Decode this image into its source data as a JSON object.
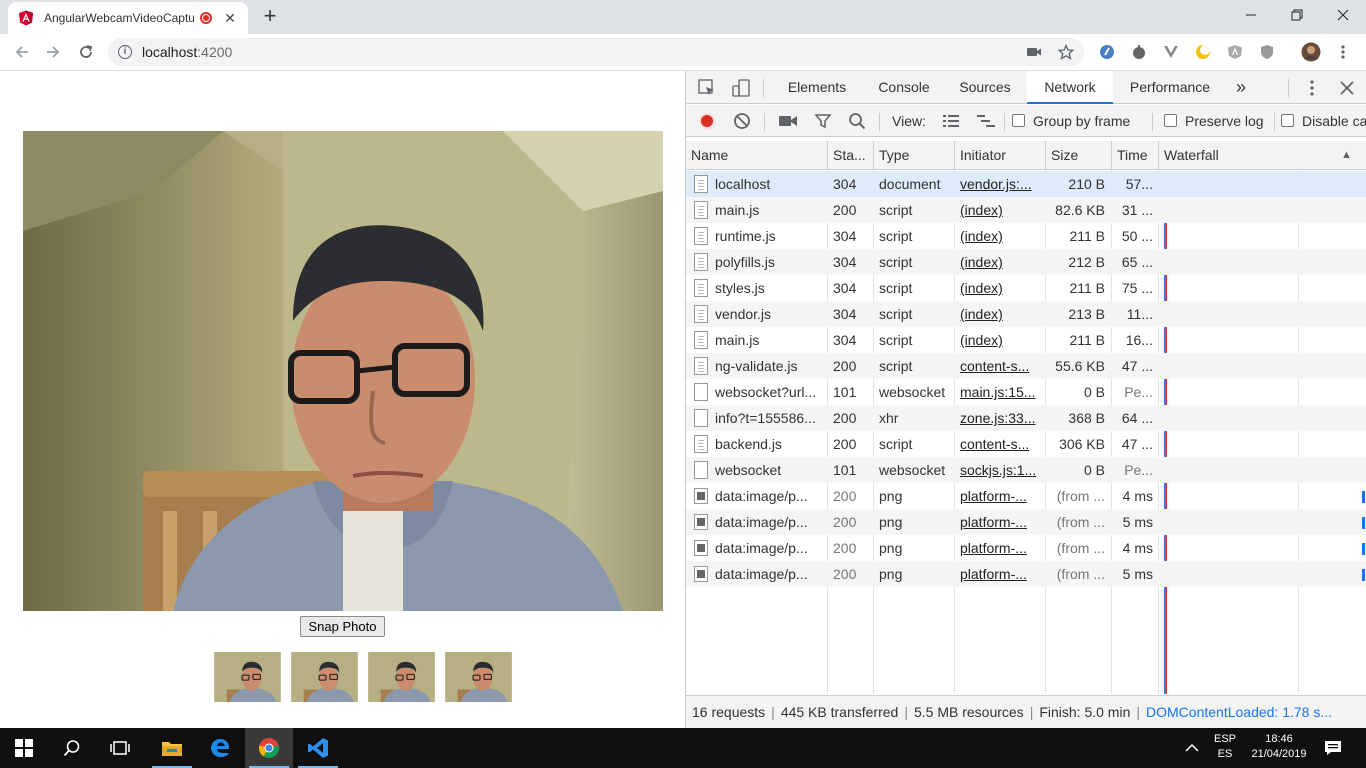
{
  "browser": {
    "tab_title": "AngularWebcamVideoCapture",
    "new_tab_symbol": "+",
    "close_symbol": "✕",
    "url_host": "localhost",
    "url_port": ":4200",
    "window_controls": {
      "minimize": "—",
      "restore": "❐",
      "close": "✕"
    }
  },
  "page": {
    "snap_button": "Snap Photo",
    "thumbnail_count": 4
  },
  "devtools": {
    "tabs": [
      "Elements",
      "Console",
      "Sources",
      "Network",
      "Performance"
    ],
    "active_tab": "Network",
    "more_tabs": "»",
    "toolbar": {
      "view_label": "View:",
      "group_by_frame": "Group by frame",
      "preserve_log": "Preserve log",
      "disable_cache": "Disable cache"
    },
    "columns": [
      "Name",
      "Sta...",
      "Type",
      "Initiator",
      "Size",
      "Time",
      "Waterfall"
    ],
    "sort_indicator": "▲",
    "requests": [
      {
        "name": "localhost",
        "status": "304",
        "type": "document",
        "initiator": "vendor.js:...",
        "size": "210 B",
        "time": "57...",
        "icon": "doc",
        "selected": true
      },
      {
        "name": "main.js",
        "status": "200",
        "type": "script",
        "initiator": "(index)",
        "size": "82.6 KB",
        "time": "31 ...",
        "icon": "doc"
      },
      {
        "name": "runtime.js",
        "status": "304",
        "type": "script",
        "initiator": "(index)",
        "size": "211 B",
        "time": "50 ...",
        "icon": "doc"
      },
      {
        "name": "polyfills.js",
        "status": "304",
        "type": "script",
        "initiator": "(index)",
        "size": "212 B",
        "time": "65 ...",
        "icon": "doc"
      },
      {
        "name": "styles.js",
        "status": "304",
        "type": "script",
        "initiator": "(index)",
        "size": "211 B",
        "time": "75 ...",
        "icon": "doc"
      },
      {
        "name": "vendor.js",
        "status": "304",
        "type": "script",
        "initiator": "(index)",
        "size": "213 B",
        "time": "11...",
        "icon": "doc"
      },
      {
        "name": "main.js",
        "status": "304",
        "type": "script",
        "initiator": "(index)",
        "size": "211 B",
        "time": "16...",
        "icon": "doc"
      },
      {
        "name": "ng-validate.js",
        "status": "200",
        "type": "script",
        "initiator": "content-s...",
        "size": "55.6 KB",
        "time": "47 ...",
        "icon": "doc"
      },
      {
        "name": "websocket?url...",
        "status": "101",
        "type": "websocket",
        "initiator": "main.js:15...",
        "size": "0 B",
        "time": "Pe...",
        "icon": "plain",
        "dim_time": true
      },
      {
        "name": "info?t=155586...",
        "status": "200",
        "type": "xhr",
        "initiator": "zone.js:33...",
        "size": "368 B",
        "time": "64 ...",
        "icon": "plain"
      },
      {
        "name": "backend.js",
        "status": "200",
        "type": "script",
        "initiator": "content-s...",
        "size": "306 KB",
        "time": "47 ...",
        "icon": "doc"
      },
      {
        "name": "websocket",
        "status": "101",
        "type": "websocket",
        "initiator": "sockjs.js:1...",
        "size": "0 B",
        "time": "Pe...",
        "icon": "plain",
        "dim_time": true
      },
      {
        "name": "data:image/p...",
        "status": "200",
        "type": "png",
        "initiator": "platform-...",
        "size": "(from ...",
        "time": "4 ms",
        "icon": "img",
        "dim_status": true,
        "dim_size": true
      },
      {
        "name": "data:image/p...",
        "status": "200",
        "type": "png",
        "initiator": "platform-...",
        "size": "(from ...",
        "time": "5 ms",
        "icon": "img",
        "dim_status": true,
        "dim_size": true
      },
      {
        "name": "data:image/p...",
        "status": "200",
        "type": "png",
        "initiator": "platform-...",
        "size": "(from ...",
        "time": "4 ms",
        "icon": "img",
        "dim_status": true,
        "dim_size": true
      },
      {
        "name": "data:image/p...",
        "status": "200",
        "type": "png",
        "initiator": "platform-...",
        "size": "(from ...",
        "time": "5 ms",
        "icon": "img",
        "dim_status": true,
        "dim_size": true
      }
    ],
    "status_bar": {
      "requests": "16 requests",
      "transferred": "445 KB transferred",
      "resources": "5.5 MB resources",
      "finish": "Finish: 5.0 min",
      "dom_content_loaded": "DOMContentLoaded: 1.78 s..."
    }
  },
  "taskbar": {
    "lang_top": "ESP",
    "lang_bottom": "ES",
    "time": "18:46",
    "date": "21/04/2019"
  },
  "colors": {
    "accent": "#1a73e8",
    "record": "#d93025",
    "angular": "#dd0031"
  }
}
